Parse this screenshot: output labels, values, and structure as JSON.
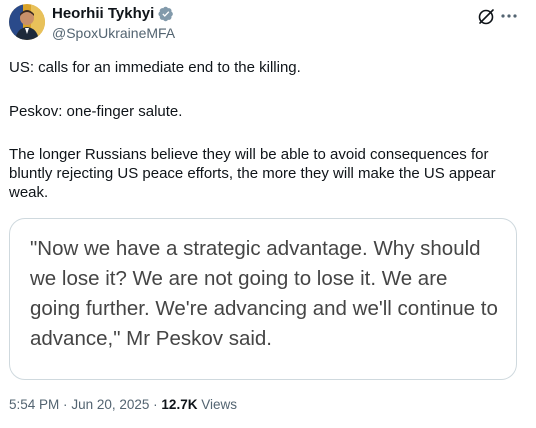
{
  "author": {
    "display_name": "Heorhii Tykhyi",
    "handle": "@SpoxUkraineMFA",
    "avatar_icon": "profile-photo",
    "verified_icon": "verified-badge-icon",
    "verified_color": "#829aab"
  },
  "header_actions": {
    "grok_icon": "grok-icon",
    "more_icon": "more-icon"
  },
  "post": {
    "paragraphs": [
      "US: calls for an immediate end to the killing.",
      "Peskov: one-finger salute.",
      "The longer Russians believe they will be able to avoid consequences for bluntly rejecting US peace efforts, the more they will make the US appear weak."
    ]
  },
  "quote_card": {
    "text": "\"Now we have a strategic advantage. Why should we lose it? We are not going to lose it. We are going further. We're advancing and we'll continue to advance,\" Mr Peskov said."
  },
  "meta": {
    "time": "5:54 PM",
    "separator": "·",
    "date": "Jun 20, 2025",
    "views_count": "12.7K",
    "views_label": "Views"
  },
  "colors": {
    "text_primary": "#0f1419",
    "text_secondary": "#536471",
    "border": "#cfd9de",
    "quote_text": "#454545"
  }
}
